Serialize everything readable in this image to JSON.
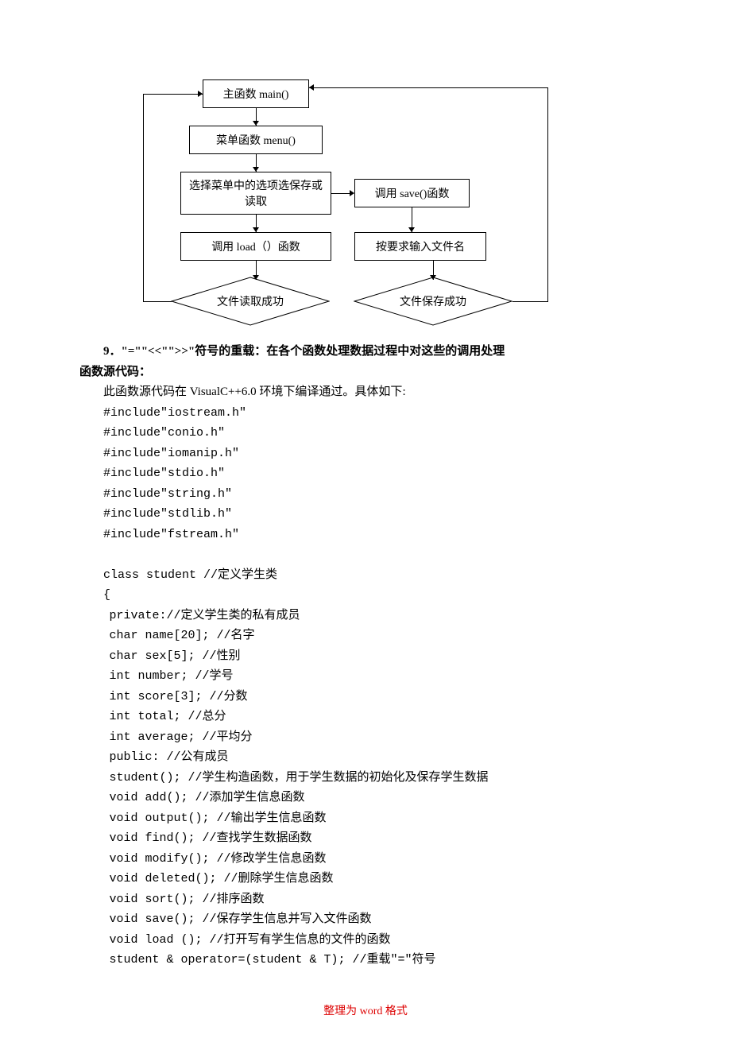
{
  "flow": {
    "b1": "主函数 main()",
    "b2": "菜单函数 menu()",
    "b3": "选择菜单中的选项选保存或读取",
    "b4": "调用 save()函数",
    "b5": "调用 load（）函数",
    "b6": "按要求输入文件名",
    "d1": "文件读取成功",
    "d2": "文件保存成功"
  },
  "heading": "9．\"=\"\"<<\"\">>\"符号的重载：在各个函数处理数据过程中对这些的调用处理",
  "heading2": "函数源代码：",
  "intro": "此函数源代码在 VisualC++6.0 环境下编译通过。具体如下:",
  "code": [
    "#include\"iostream.h\"",
    "#include\"conio.h\"",
    "#include\"iomanip.h\"",
    "#include\"stdio.h\"",
    "#include\"string.h\"",
    "#include\"stdlib.h\"",
    "#include\"fstream.h\"",
    "",
    "class student //定义学生类",
    "{",
    " private://定义学生类的私有成员",
    " char name[20]; //名字",
    " char sex[5]; //性别",
    " int number; //学号",
    " int score[3]; //分数",
    " int total; //总分",
    " int average; //平均分",
    " public: //公有成员",
    " student(); //学生构造函数，用于学生数据的初始化及保存学生数据",
    " void add(); //添加学生信息函数",
    " void output(); //输出学生信息函数",
    " void find(); //查找学生数据函数",
    " void modify(); //修改学生信息函数",
    " void deleted(); //删除学生信息函数",
    " void sort(); //排序函数",
    " void save(); //保存学生信息并写入文件函数",
    " void load (); //打开写有学生信息的文件的函数",
    " student & operator=(student & T); //重载\"=\"符号"
  ],
  "footer": "整理为 word 格式"
}
